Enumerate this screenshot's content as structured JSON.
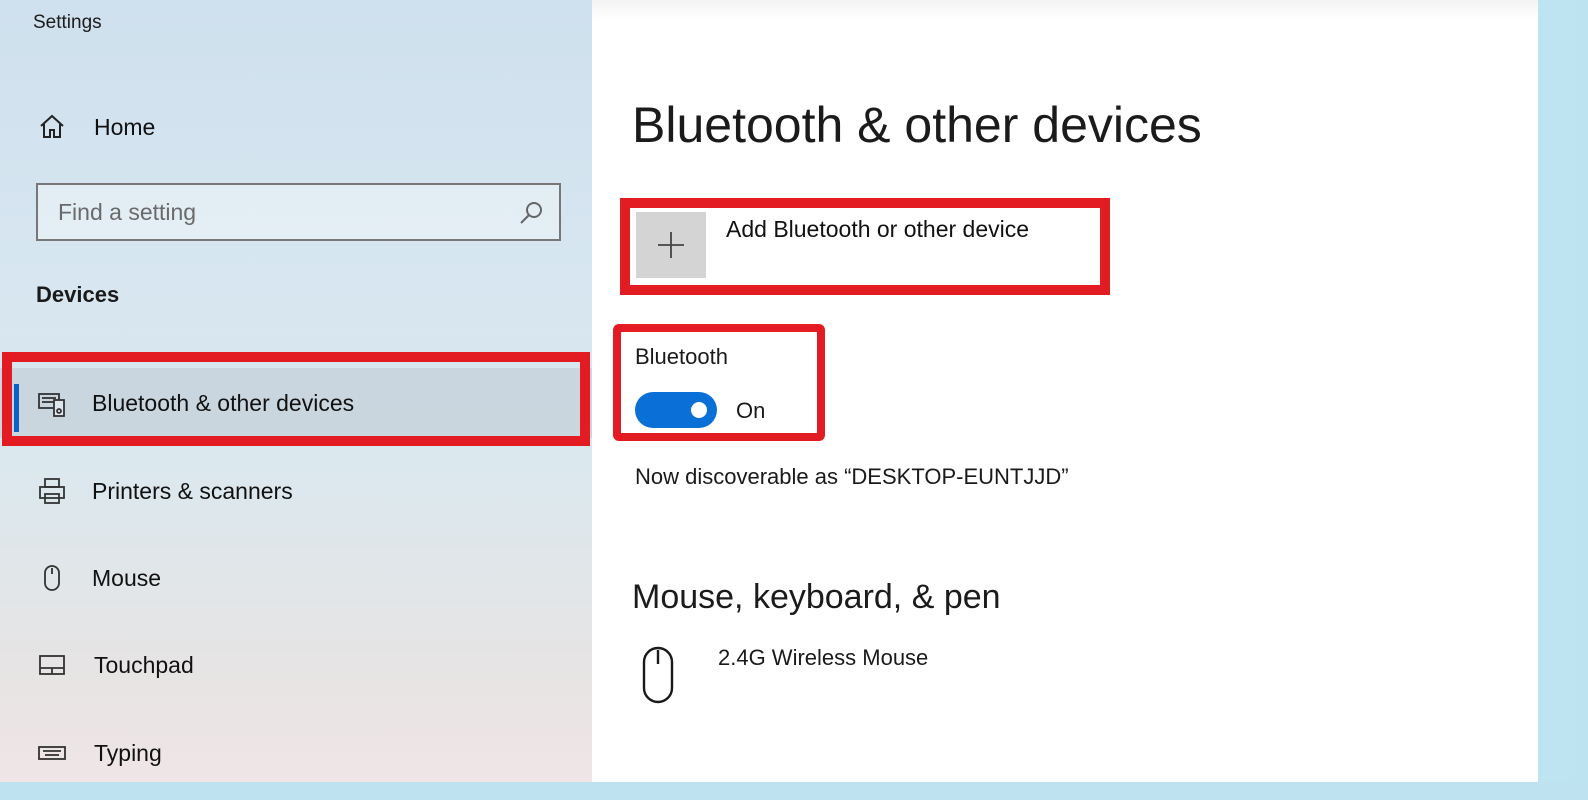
{
  "window": {
    "title": "Settings"
  },
  "sidebar": {
    "home_label": "Home",
    "search_placeholder": "Find a setting",
    "section_heading": "Devices",
    "items": [
      {
        "label": "Bluetooth & other devices",
        "icon": "bluetooth-devices-icon",
        "active": true
      },
      {
        "label": "Printers & scanners",
        "icon": "printer-icon",
        "active": false
      },
      {
        "label": "Mouse",
        "icon": "mouse-icon",
        "active": false
      },
      {
        "label": "Touchpad",
        "icon": "touchpad-icon",
        "active": false
      },
      {
        "label": "Typing",
        "icon": "keyboard-icon",
        "active": false
      }
    ]
  },
  "main": {
    "title": "Bluetooth & other devices",
    "add_device_label": "Add Bluetooth or other device",
    "bluetooth": {
      "label": "Bluetooth",
      "state_label": "On",
      "enabled": true
    },
    "discoverable_text": "Now discoverable as “DESKTOP-EUNTJJD”",
    "section_heading": "Mouse, keyboard, & pen",
    "devices": [
      {
        "name": "2.4G Wireless Mouse",
        "icon": "mouse-icon"
      }
    ]
  },
  "colors": {
    "accent": "#0a6fd6",
    "highlight": "#e31c24"
  }
}
